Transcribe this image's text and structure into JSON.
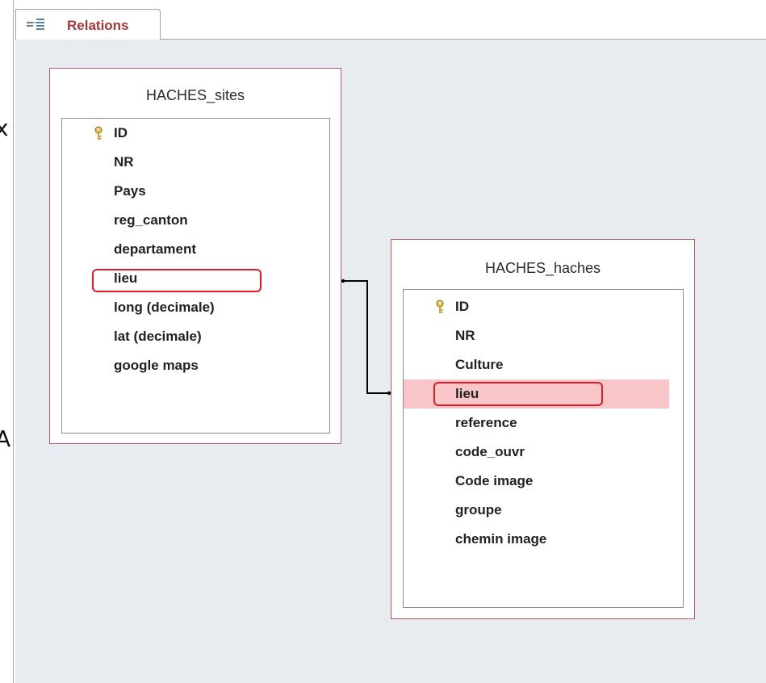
{
  "window": {
    "edge_glyphs": [
      "x",
      "A"
    ]
  },
  "tab": {
    "label": "Relations",
    "icon": "relationships-icon"
  },
  "tables": [
    {
      "name": "HACHES_sites",
      "fields": [
        {
          "name": "ID",
          "primary_key": true
        },
        {
          "name": "NR"
        },
        {
          "name": "Pays"
        },
        {
          "name": "reg_canton"
        },
        {
          "name": "departament"
        },
        {
          "name": "lieu",
          "highlighted": true
        },
        {
          "name": "long (decimale)"
        },
        {
          "name": "lat (decimale)"
        },
        {
          "name": "google maps"
        }
      ]
    },
    {
      "name": "HACHES_haches",
      "fields": [
        {
          "name": "ID",
          "primary_key": true
        },
        {
          "name": "NR"
        },
        {
          "name": "Culture"
        },
        {
          "name": "lieu",
          "highlighted": true,
          "selected": true
        },
        {
          "name": "reference"
        },
        {
          "name": "code_ouvr"
        },
        {
          "name": "Code image"
        },
        {
          "name": "groupe"
        },
        {
          "name": "chemin image"
        }
      ]
    }
  ],
  "relationship": {
    "from": "HACHES_sites.lieu",
    "to": "HACHES_haches.lieu"
  },
  "colors": {
    "tab_label": "#a4373a",
    "table_border": "#b85a60",
    "highlight_box": "#e21b22",
    "selected_row": "#f8c6c8",
    "canvas": "#e8ecf0"
  }
}
